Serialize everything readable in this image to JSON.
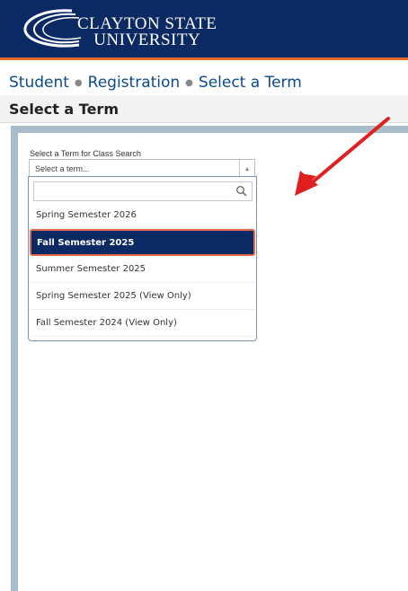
{
  "header": {
    "logo_line1": "CLAYTON STATE",
    "logo_line2": "UNIVERSITY",
    "brand_color": "#0b2a63",
    "accent_color": "#e06a2a"
  },
  "breadcrumb": [
    "Student",
    "Registration",
    "Select a Term"
  ],
  "page_title": "Select a Term",
  "form": {
    "label": "Select a Term for Class Search",
    "select_placeholder": "Select a term...",
    "search_placeholder": ""
  },
  "terms": [
    {
      "label": "Spring Semester 2026",
      "selected": false
    },
    {
      "label": "Fall Semester 2025",
      "selected": true
    },
    {
      "label": "Summer Semester 2025",
      "selected": false
    },
    {
      "label": "Spring Semester 2025 (View Only)",
      "selected": false
    },
    {
      "label": "Fall Semester 2024 (View Only)",
      "selected": false
    }
  ],
  "annotation": {
    "color": "#e02020"
  }
}
